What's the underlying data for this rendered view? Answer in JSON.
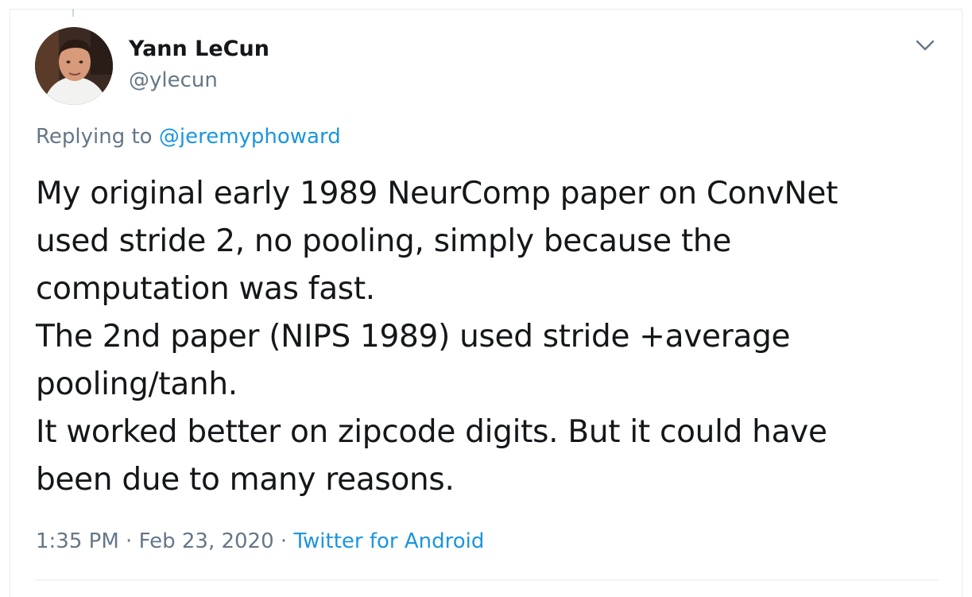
{
  "tweet": {
    "author": {
      "display_name": "Yann LeCun",
      "handle": "@ylecun"
    },
    "reply": {
      "prefix": "Replying to ",
      "mention": "@jeremyphoward"
    },
    "text": "My original early 1989 NeurComp paper on ConvNet\nused stride 2, no pooling, simply because the\ncomputation was fast.\nThe 2nd paper (NIPS 1989) used stride +average\npooling/tanh.\nIt worked better on zipcode digits. But it could have\nbeen due to many reasons.",
    "time": "1:35 PM",
    "separator": " · ",
    "date": "Feb 23, 2020",
    "source": "Twitter for Android"
  },
  "icons": {
    "menu": "chevron-down-icon"
  },
  "colors": {
    "link_blue": "#1b95e0",
    "secondary_text": "#657786",
    "primary_text": "#14171a",
    "border": "#e6ecf0"
  }
}
